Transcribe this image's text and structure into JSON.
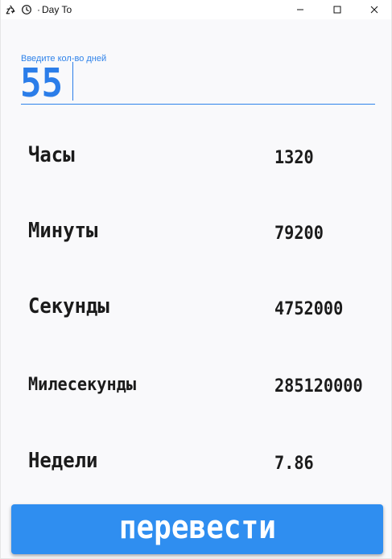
{
  "window": {
    "title": "Day To",
    "title_prefix": "·"
  },
  "titlebar_icons": {
    "left_icon_1": "recycle-icon",
    "left_icon_2": "clock-icon"
  },
  "window_controls": {
    "minimize_icon": "minimize-icon",
    "maximize_icon": "maximize-icon",
    "close_icon": "close-icon"
  },
  "input": {
    "label": "Введите кол-во дней",
    "value": "55"
  },
  "results": [
    {
      "label": "Часы",
      "value": "1320"
    },
    {
      "label": "Минуты",
      "value": "79200"
    },
    {
      "label": "Секунды",
      "value": "4752000"
    },
    {
      "label": "Милесекунды",
      "value": "285120000"
    },
    {
      "label": "Недели",
      "value": "7.86"
    }
  ],
  "action": {
    "label": "перевести"
  },
  "colors": {
    "accent": "#2f83ea",
    "button": "#2f8ef0",
    "text": "#1b1b1b",
    "background": "#f9f9fb"
  }
}
